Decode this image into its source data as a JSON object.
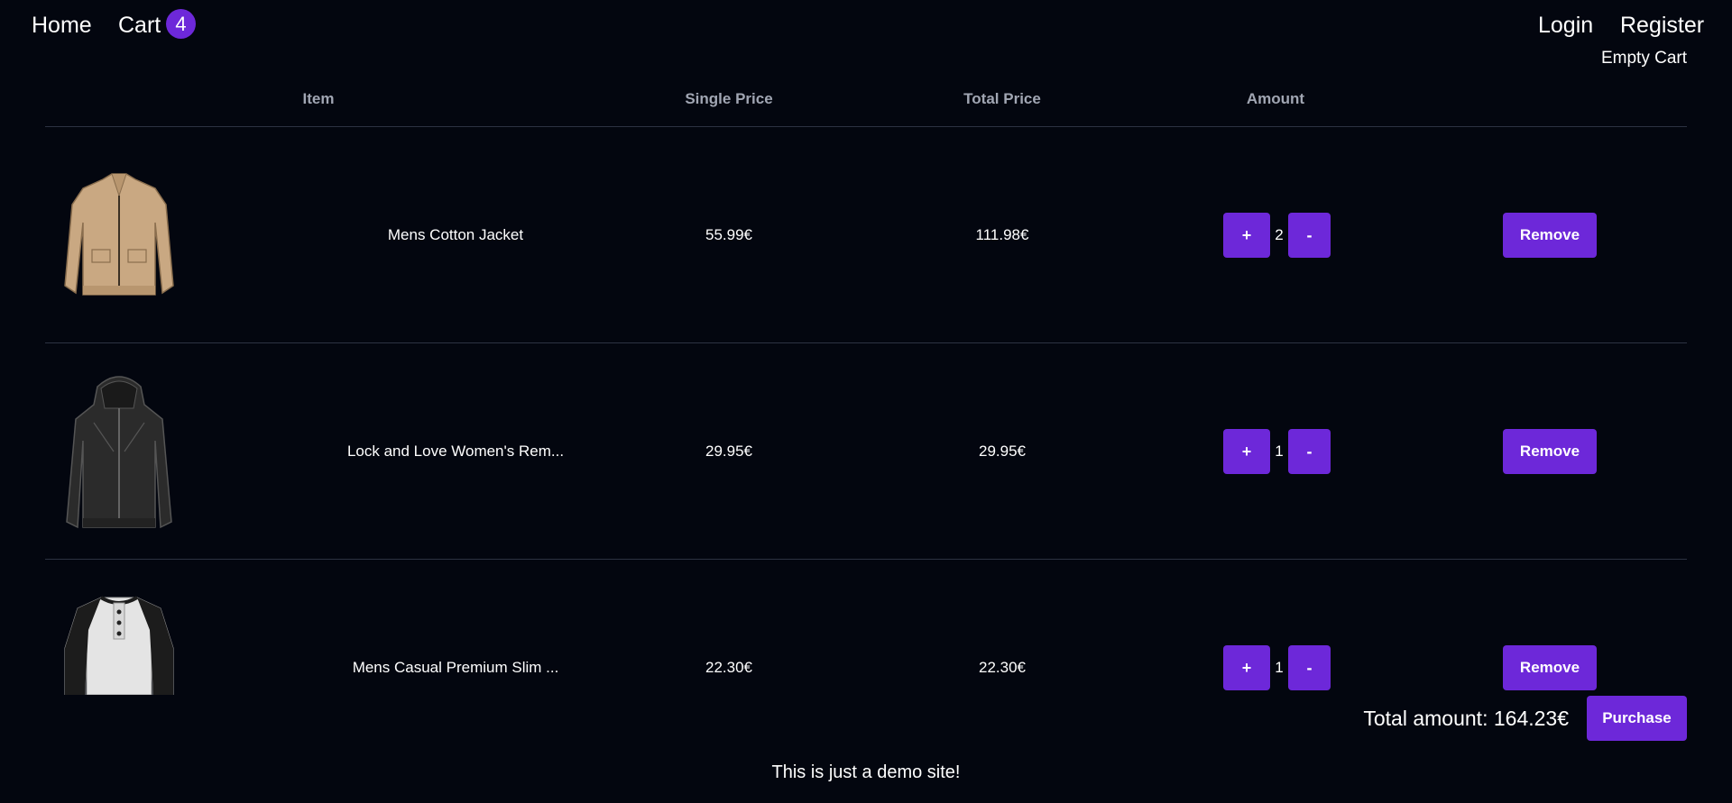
{
  "nav": {
    "home_label": "Home",
    "cart_label": "Cart",
    "cart_count": "4",
    "login_label": "Login",
    "register_label": "Register",
    "empty_cart_label": "Empty Cart"
  },
  "table": {
    "headers": {
      "item": "Item",
      "single_price": "Single Price",
      "total_price": "Total Price",
      "amount": "Amount"
    },
    "rows": [
      {
        "image_icon": "jacket-tan-icon",
        "name": "Mens Cotton Jacket",
        "single_price": "55.99€",
        "total_price": "111.98€",
        "quantity": "2",
        "plus_label": "+",
        "minus_label": "-",
        "remove_label": "Remove"
      },
      {
        "image_icon": "jacket-black-hooded-icon",
        "name": "Lock and Love Women's Rem...",
        "single_price": "29.95€",
        "total_price": "29.95€",
        "quantity": "1",
        "plus_label": "+",
        "minus_label": "-",
        "remove_label": "Remove"
      },
      {
        "image_icon": "shirt-raglan-icon",
        "name": "Mens Casual Premium Slim ...",
        "single_price": "22.30€",
        "total_price": "22.30€",
        "quantity": "1",
        "plus_label": "+",
        "minus_label": "-",
        "remove_label": "Remove"
      }
    ]
  },
  "summary": {
    "total_label": "Total amount:",
    "total_value": "164.23€",
    "purchase_label": "Purchase"
  },
  "footer": {
    "text": "This is just a demo site!"
  },
  "colors": {
    "background": "#03060f",
    "accent": "#6d28d9",
    "divider": "#2c3242",
    "header_text": "#a1a6b3"
  }
}
